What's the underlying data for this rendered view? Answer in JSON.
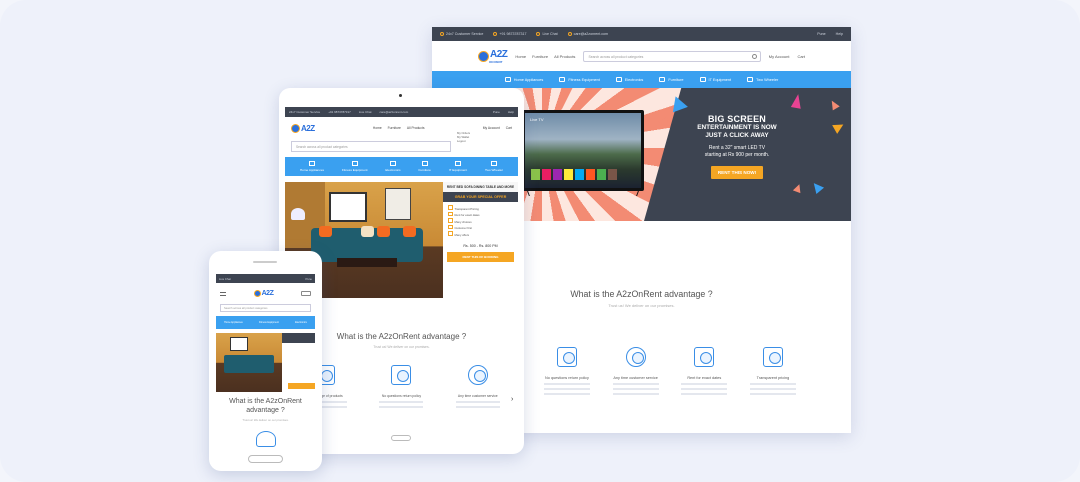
{
  "colors": {
    "accent": "#3aa0f0",
    "dark": "#3d4451",
    "orange": "#f5a623",
    "burst": "#f38b73"
  },
  "desktop": {
    "topbar": [
      "24x7 Customer Service",
      "+91 9873787317",
      "Live Chat",
      "care@a2zonrent.com"
    ],
    "city": "Pune",
    "help": "Help",
    "logo": "A2Z",
    "logo_sub": "ON RENT",
    "nav": [
      "Home",
      "Furniture",
      "All Products"
    ],
    "search_placeholder": "Search across all product categories",
    "account": "My Account",
    "cart": "Cart",
    "categories": [
      "Home Appliances",
      "Fitness Equipment",
      "Electronics",
      "Furniture",
      "IT Equipment",
      "Two Wheeler"
    ],
    "tv_label": "Live TV",
    "promo": {
      "title": "BIG SCREEN",
      "line1": "ENTERTAINMENT IS NOW",
      "line2": "JUST A CLICK AWAY",
      "desc1": "Rent a 32\" smart LED TV",
      "desc2": "starting at Rs 900 per month.",
      "cta": "RENT THIS NOW!"
    },
    "advantage_title": "What is the A2zOnRent advantage ?",
    "advantage_sub": "Trust us! We deliver on our promises.",
    "features": [
      "No questions return policy",
      "Any time customer service",
      "Rent for exact dates",
      "Transparent pricing"
    ]
  },
  "tablet": {
    "topbar": [
      "24x7 Customer Service",
      "+91 9873787317",
      "Live Chat",
      "care@a2zonrent.com"
    ],
    "city": "Pune",
    "help": "Help",
    "nav": [
      "Home",
      "Furniture",
      "All Products"
    ],
    "account": "My Account",
    "cart": "Cart",
    "account_menu": [
      "My Orders",
      "My Wallet",
      "Logout"
    ],
    "search_placeholder": "Search across all product categories",
    "categories": [
      "Home Appliances",
      "Fitness Equipment",
      "Electronics",
      "Furniture",
      "IT Equipment",
      "Two Wheeler"
    ],
    "offer": {
      "top": "RENT BED SOFA DINING TABLE AND MORE",
      "badge": "GRAB YOUR SPECIAL OFFER",
      "items": [
        "Transparent Pricing",
        "Rent for exact dates",
        "Many choices",
        "Customer first",
        "Many offers"
      ],
      "price": "Rs. 500 - Rs. 800 PM",
      "button": "RENT THIS OF BOOKING"
    },
    "advantage_title": "What is the A2zOnRent advantage ?",
    "advantage_sub": "Trust us! We deliver on our promises.",
    "features": [
      "Wide range of products",
      "No questions return policy",
      "Any time customer service"
    ],
    "arrow": "›"
  },
  "phone": {
    "topbar_left": "Live Chat",
    "topbar_right": "Pune",
    "search_placeholder": "Search across all product categories",
    "categories": [
      "Home Appliances",
      "Fitness Equipment",
      "Electronics"
    ],
    "advantage_title": "What is the A2zOnRent advantage ?",
    "advantage_sub": "Trust us! We deliver on our promises."
  }
}
